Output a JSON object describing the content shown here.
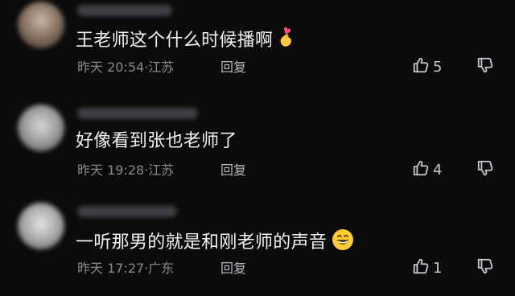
{
  "comments": [
    {
      "text": "王老师这个什么时候播啊",
      "emoji": "heart-hands-icon",
      "time": "昨天 20:54",
      "location": "江苏",
      "reply_label": "回复",
      "likes": "5"
    },
    {
      "text": "好像看到张也老师了",
      "emoji": "",
      "time": "昨天 19:28",
      "location": "江苏",
      "reply_label": "回复",
      "likes": "4"
    },
    {
      "text": "一听那男的就是和刚老师的声音",
      "emoji": "grinning-face-icon",
      "time": "昨天 17:27",
      "location": "广东",
      "reply_label": "回复",
      "likes": "1"
    }
  ],
  "separator": "·",
  "colors": {
    "background": "#0b0b0d",
    "text": "#f2f2f2",
    "meta": "#8a8a8e",
    "icon": "#c8c8cc"
  }
}
